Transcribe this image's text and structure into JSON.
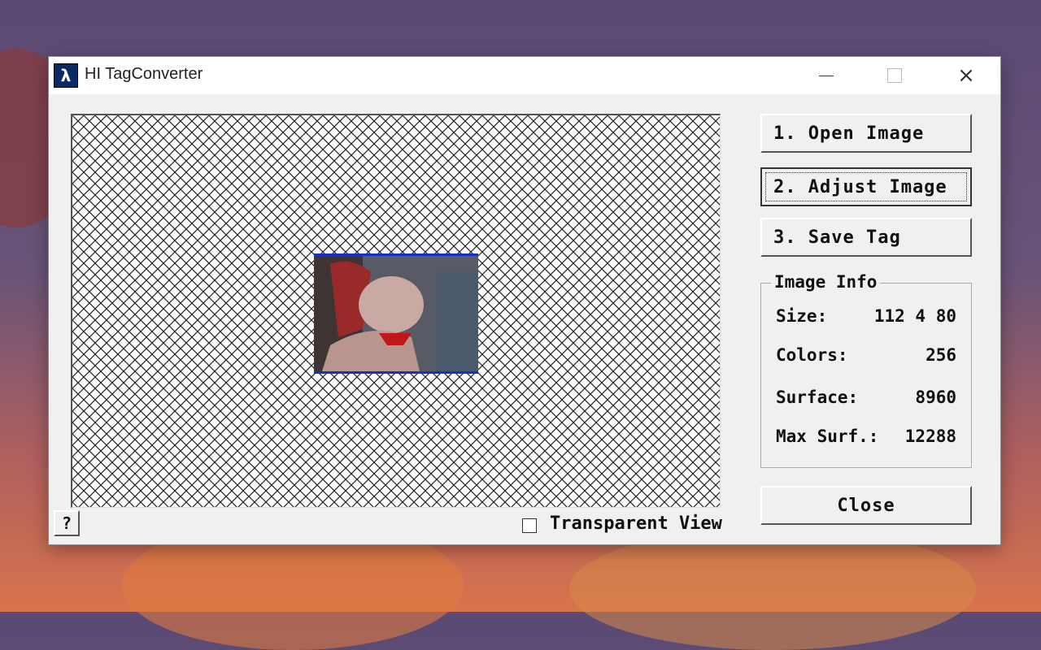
{
  "window": {
    "title": "HI TagConverter",
    "icon": "half-life-lambda-icon",
    "controls": {
      "minimize": "minimize-icon",
      "maximize": "maximize-icon",
      "close": "×"
    }
  },
  "buttons": {
    "open": "1. Open Image",
    "adjust": "2. Adjust Image",
    "save": "3. Save Tag",
    "close": "Close",
    "help": "?"
  },
  "image_info": {
    "legend": "Image Info",
    "rows": [
      {
        "label": "Size:",
        "value": "112 4 80"
      },
      {
        "label": "Colors:",
        "value": "256"
      },
      {
        "label": "Surface:",
        "value": "8960"
      },
      {
        "label": "Max Surf.:",
        "value": "12288"
      }
    ]
  },
  "transparent_view": {
    "label": "Transparent View",
    "checked": false
  },
  "colors": {
    "accent_blue": "#1530c8",
    "window_bg": "#f0f0f0"
  }
}
